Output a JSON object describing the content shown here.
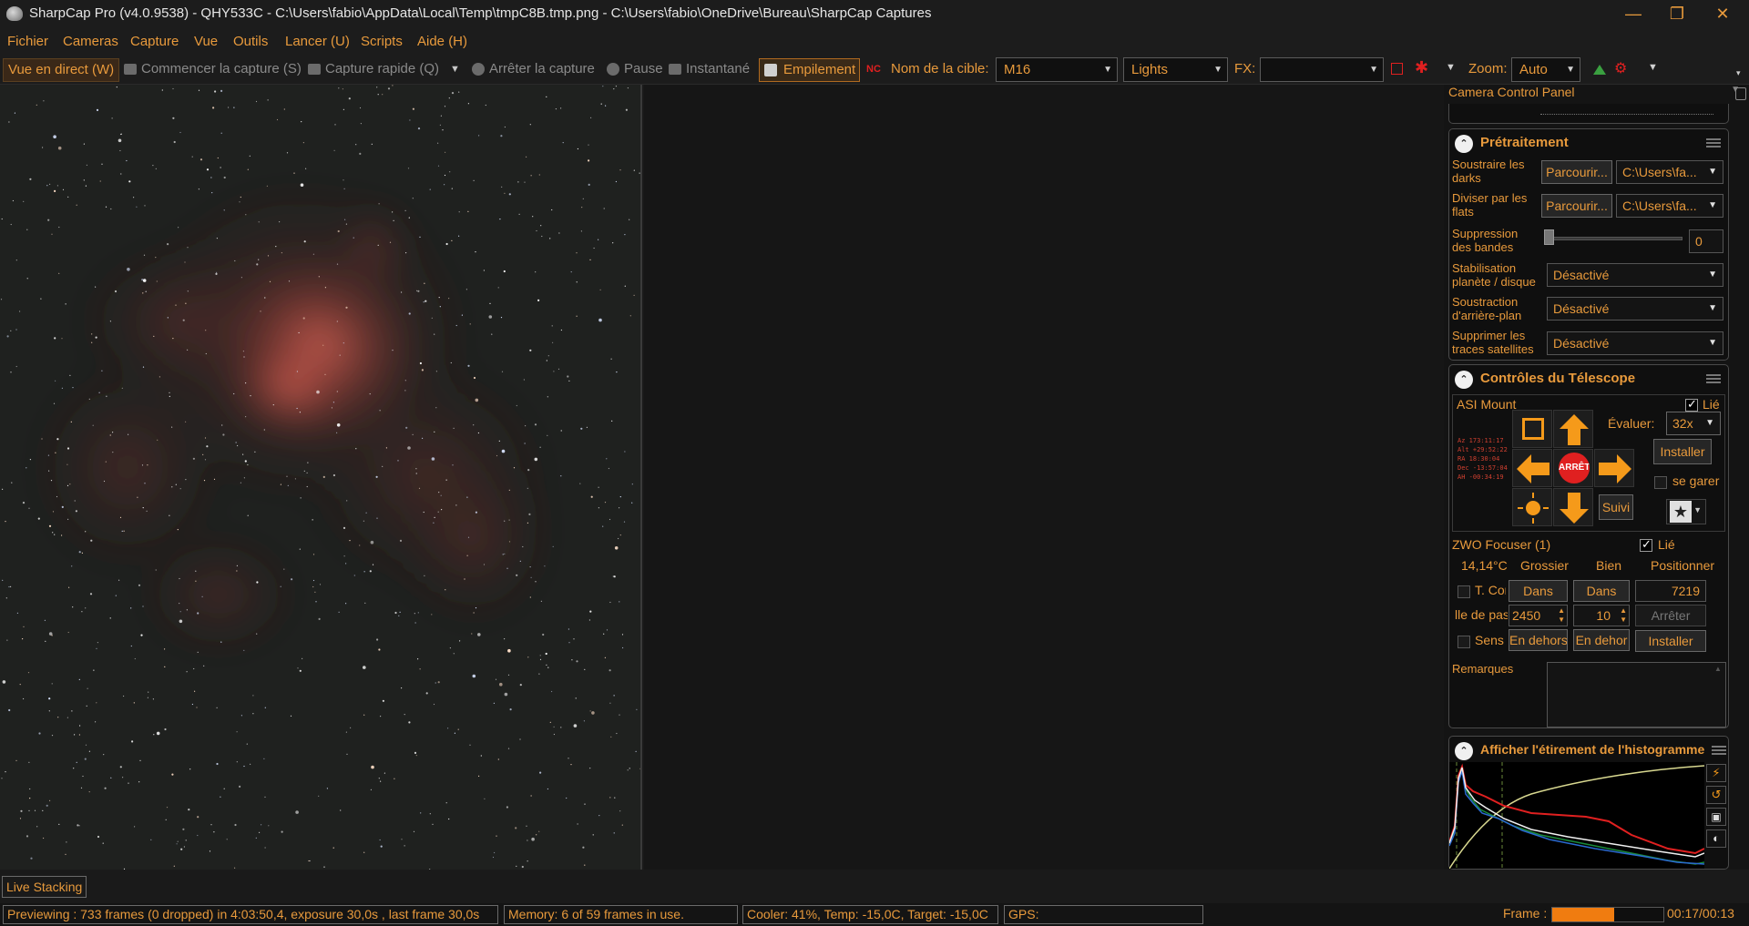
{
  "window": {
    "title": "SharpCap Pro (v4.0.9538) - QHY533C - C:\\Users\\fabio\\AppData\\Local\\Temp\\tmpC8B.tmp.png - C:\\Users\\fabio\\OneDrive\\Bureau\\SharpCap Captures",
    "minimize": "—",
    "maximize": "❐",
    "close": "✕"
  },
  "menu": [
    "Fichier",
    "Cameras",
    "Capture",
    "Vue",
    "Outils",
    "Lancer (U)",
    "Scripts",
    "Aide (H)"
  ],
  "toolbar": {
    "live_view": "Vue en direct (W)",
    "start_capture": "Commencer la capture (S)",
    "quick_capture": "Capture rapide (Q)",
    "stop_capture": "Arrêter la capture",
    "pause": "Pause",
    "snapshot": "Instantané",
    "stacking": "Empilement",
    "target_label": "Nom de la cible:",
    "target_value": "M16",
    "frame_type": "Lights",
    "fx_label": "FX:",
    "fx_value": "",
    "zoom_label": "Zoom:",
    "zoom_value": "Auto"
  },
  "panel": {
    "header": "Camera Control Panel",
    "preprocessing": {
      "title": "Prétraitement",
      "darks_label": "Soustraire les darks",
      "darks_browse": "Parcourir...",
      "darks_path": "C:\\Users\\fa...",
      "flats_label": "Diviser par les flats",
      "flats_browse": "Parcourir...",
      "flats_path": "C:\\Users\\fa...",
      "banding_label": "Suppression des bandes",
      "banding_value": "0",
      "stab_label": "Stabilisation planète / disque",
      "stab_value": "Désactivé",
      "bg_label": "Soustraction d'arrière-plan",
      "bg_value": "Désactivé",
      "sat_label": "Supprimer les traces satellites",
      "sat_value": "Désactivé"
    },
    "telescope": {
      "title": "Contrôles du Télescope",
      "mount_name": "ASI Mount",
      "linked": "Lié",
      "rate_label": "Évaluer:",
      "rate_value": "32x",
      "stop": "ARRÊTE",
      "install": "Installer",
      "park": "se garer",
      "track": "Suivi",
      "coords": [
        "Az  173:11:17",
        "Alt +29:52:22",
        "RA   18:30:04",
        "Dec -13:57:04",
        "AH  -00:34:19"
      ]
    },
    "focuser": {
      "name": "ZWO Focuser (1)",
      "linked": "Lié",
      "temp": "14,14°C",
      "coarse": "Grossier",
      "fine": "Bien",
      "position_label": "Positionner",
      "tcomp": "T. Con",
      "in1": "Dans",
      "in2": "Dans",
      "position_value": "7219",
      "step_label": "lle de pas",
      "step_coarse": "2450",
      "step_fine": "10",
      "stop": "Arrêter",
      "reverse": "Sens ir",
      "out1": "En dehors",
      "out2": "En dehor",
      "install": "Installer"
    },
    "notes_label": "Remarques",
    "histogram_title": "Afficher l'étirement de l'histogramme"
  },
  "live_stacking": "Live Stacking",
  "status": {
    "preview": "Previewing : 733 frames (0 dropped) in 4:03:50,4, exposure 30,0s , last frame 30,0s",
    "memory": "Memory: 6 of 59 frames in use.",
    "cooler": "Cooler: 41%, Temp: -15,0C, Target: -15,0C",
    "gps": "GPS:",
    "frame_label": "Frame :",
    "frame_progress": 0.56,
    "time": "00:17/00:13"
  },
  "colors": {
    "accent": "#e89a3c",
    "background": "#1a1a1a",
    "stop_red": "#e02020",
    "arrow_orange": "#f59a1a"
  }
}
